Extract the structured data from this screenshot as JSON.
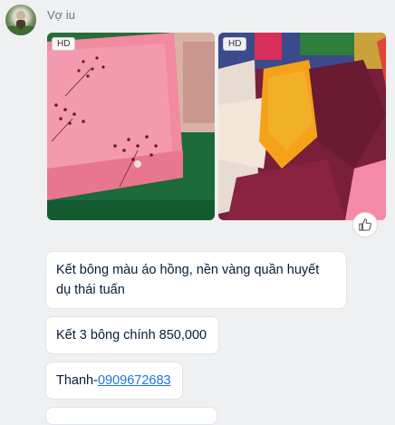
{
  "sender": {
    "name": "Vợ iu"
  },
  "images": [
    {
      "badge": "HD",
      "icon": "fabric-photo-pink"
    },
    {
      "badge": "HD",
      "icon": "fabric-photo-orange"
    }
  ],
  "reaction": {
    "icon": "thumbs-up-icon"
  },
  "messages": [
    {
      "text": "Kết bông màu áo hồng, nền vàng quần huyết dụ thái tuấn"
    },
    {
      "text": "Kết 3 bông chính 850,000"
    },
    {
      "prefix": "Thanh-",
      "phone": "0909672683"
    }
  ],
  "colors": {
    "link": "#1a73e8",
    "background": "#eef0f1"
  }
}
